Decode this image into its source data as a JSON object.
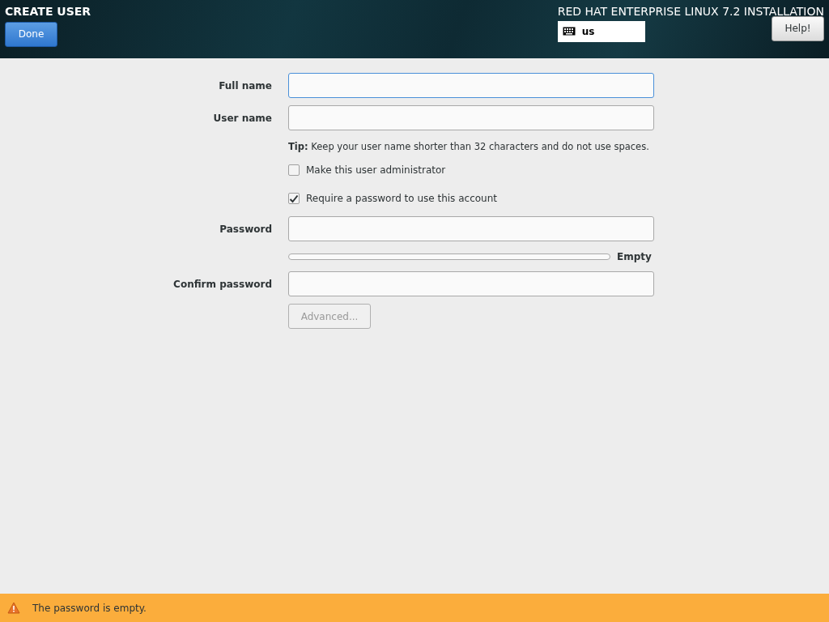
{
  "header": {
    "title": "CREATE USER",
    "done_button": "Done",
    "product": "RED HAT ENTERPRISE LINUX 7.2 INSTALLATION",
    "keyboard_layout": "us",
    "help_button": "Help!"
  },
  "full_name": {
    "label": "Full name",
    "focused": true
  },
  "user_name": {
    "label": "User name",
    "focused": false
  },
  "tip": "**Tip:** Keep your user name shorter than 32 characters and do not use spaces.",
  "checkboxes": [
    {
      "label": "Make this user administrator",
      "checked": false
    },
    {
      "label": "Require a password to use this account",
      "checked": true
    }
  ],
  "password": {
    "label": "Password",
    "focused": false
  },
  "strength": {
    "level": 0,
    "reading": "Empty"
  },
  "confirm_password": {
    "label": "Confirm password",
    "focused": false
  },
  "advanced_button": {
    "label": "Advanced...",
    "disabled": true
  },
  "status_bar": {
    "kind": "warning",
    "message": "The password is empty."
  }
}
